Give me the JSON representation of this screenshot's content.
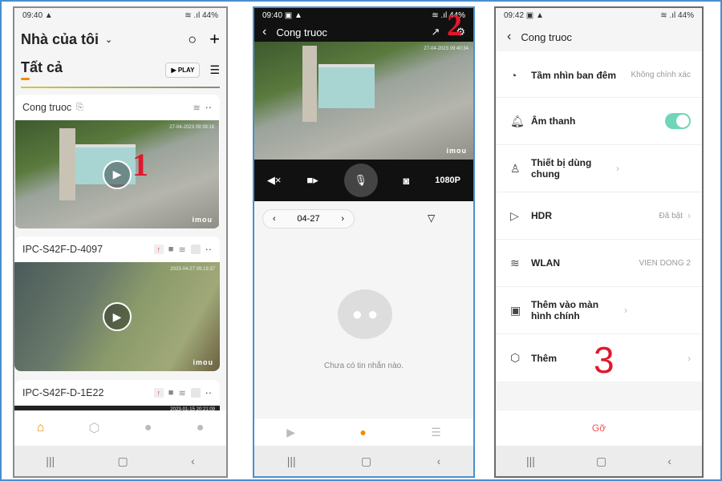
{
  "left": {
    "time": "09:40",
    "battery": "44%",
    "home_title": "Nhà của tôi",
    "tab_all": "Tất cả",
    "play_label": "PLAY",
    "devices": [
      {
        "name": "Cong truoc",
        "timestamp": "27-04-2023 09:39:18",
        "logo": "imou"
      },
      {
        "name": "IPC-S42F-D-4097",
        "timestamp": "2023-04-27 09:19:37",
        "logo": "imou"
      },
      {
        "name": "IPC-S42F-D-1E22",
        "timestamp": "2023-01-15 20:21:09"
      }
    ],
    "annotation": "1",
    "accent": "#f08c00"
  },
  "middle": {
    "time": "09:40",
    "battery": "44%",
    "title": "Cong truoc",
    "timestamp": "27-04-2023 09:40:34",
    "logo": "imou",
    "quality": "1080P",
    "date": "04-27",
    "empty_message": "Chưa có tin nhắn nào.",
    "annotation": "2"
  },
  "right": {
    "time": "09:42",
    "battery": "44%",
    "title": "Cong truoc",
    "annotation": "3",
    "remove_label": "Gỡ",
    "toggle_color": "#6fd6b8",
    "items": [
      {
        "label": "Tầm nhìn ban đêm",
        "value": "Không chính xác",
        "icon": "night-vision-icon"
      },
      {
        "label": "Âm thanh",
        "toggle": true,
        "icon": "bell-sound-icon"
      },
      {
        "label": "Thiết bị dùng chung",
        "icon": "shared-user-icon"
      },
      {
        "label": "HDR",
        "value": "Đã bật",
        "icon": "hdr-icon"
      },
      {
        "label": "WLAN",
        "value": "VIEN DONG 2",
        "icon": "wifi-icon"
      },
      {
        "label": "Thêm vào màn hình chính",
        "icon": "add-home-icon"
      },
      {
        "label": "Thêm",
        "icon": "settings-icon"
      }
    ]
  }
}
